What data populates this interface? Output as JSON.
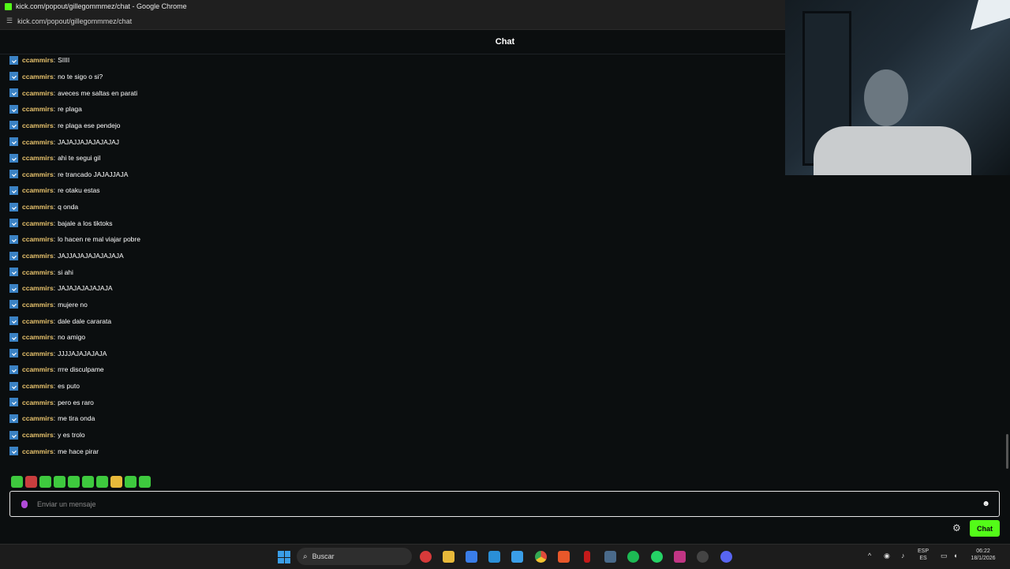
{
  "window": {
    "title": "kick.com/popout/gillegommmez/chat - Google Chrome",
    "url": "kick.com/popout/gillegommmez/chat"
  },
  "chat": {
    "header": "Chat",
    "messages": [
      {
        "user": "ccammirs",
        "text": "SIIII"
      },
      {
        "user": "ccammirs",
        "text": "no te sigo o si?"
      },
      {
        "user": "ccammirs",
        "text": "aveces me saltas en parati"
      },
      {
        "user": "ccammirs",
        "text": "re plaga"
      },
      {
        "user": "ccammirs",
        "text": "re plaga ese pendejo"
      },
      {
        "user": "ccammirs",
        "text": "JAJAJJAJAJAJAJAJ"
      },
      {
        "user": "ccammirs",
        "text": "ahi te segui gil"
      },
      {
        "user": "ccammirs",
        "text": "re trancado JAJAJJAJA"
      },
      {
        "user": "ccammirs",
        "text": "re otaku estas"
      },
      {
        "user": "ccammirs",
        "text": "q onda"
      },
      {
        "user": "ccammirs",
        "text": "bajale a los tiktoks"
      },
      {
        "user": "ccammirs",
        "text": "lo hacen re mal viajar pobre"
      },
      {
        "user": "ccammirs",
        "text": "JAJJAJAJAJAJAJAJA"
      },
      {
        "user": "ccammirs",
        "text": "si ahi"
      },
      {
        "user": "ccammirs",
        "text": "JAJAJAJAJAJAJA"
      },
      {
        "user": "ccammirs",
        "text": "mujere no"
      },
      {
        "user": "ccammirs",
        "text": "dale dale cararata"
      },
      {
        "user": "ccammirs",
        "text": "no amigo"
      },
      {
        "user": "ccammirs",
        "text": "JJJJAJAJAJAJA"
      },
      {
        "user": "ccammirs",
        "text": "rrre disculpame"
      },
      {
        "user": "ccammirs",
        "text": "es puto"
      },
      {
        "user": "ccammirs",
        "text": "pero es raro"
      },
      {
        "user": "ccammirs",
        "text": "me tira onda"
      },
      {
        "user": "ccammirs",
        "text": "y es trolo"
      },
      {
        "user": "ccammirs",
        "text": "me hace pirar"
      }
    ],
    "separator": ":",
    "input_placeholder": "Enviar un mensaje",
    "send_label": "Chat",
    "emotes": [
      "emote-1",
      "emote-2",
      "emote-3",
      "emote-4",
      "emote-5",
      "emote-6",
      "emote-7",
      "emote-8",
      "emote-9",
      "emote-10"
    ]
  },
  "taskbar": {
    "search_label": "Buscar",
    "lang_top": "ESP",
    "lang_bottom": "ES",
    "time": "06:22",
    "date": "18/1/2026"
  },
  "colors": {
    "accent": "#53fc18",
    "username": "#e8c36d",
    "badge": "#3b82c4"
  }
}
